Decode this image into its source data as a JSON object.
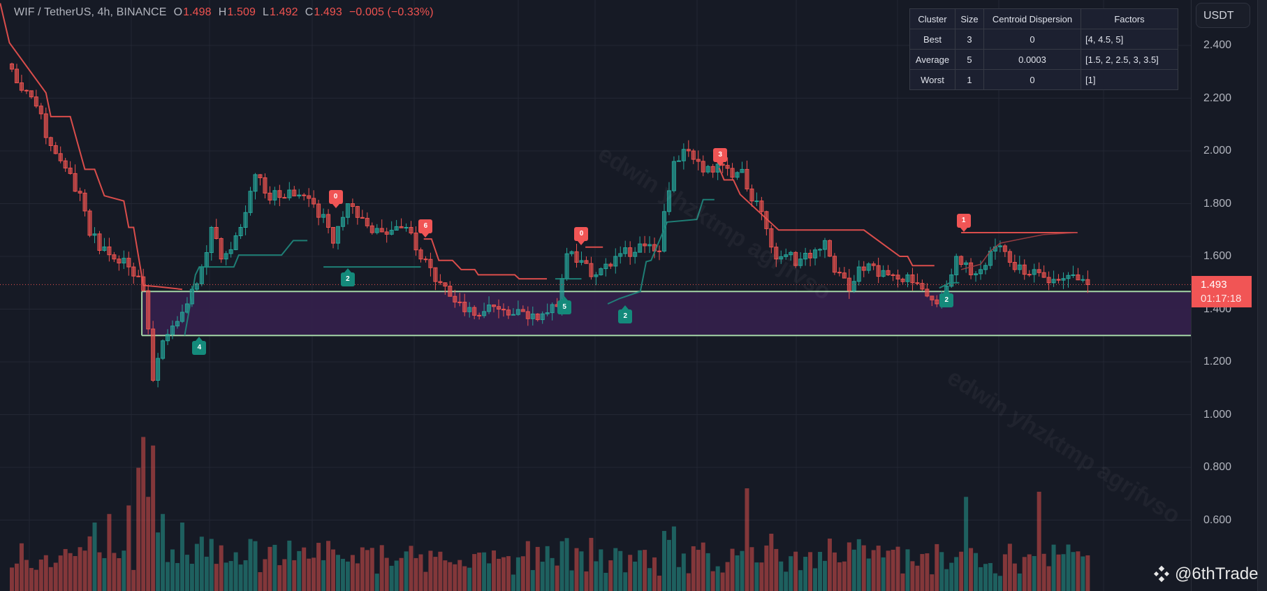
{
  "header": {
    "symbol": "WIF / TetherUS, 4h, BINANCE",
    "o_label": "O",
    "o": "1.498",
    "h_label": "H",
    "h": "1.509",
    "l_label": "L",
    "l": "1.492",
    "c_label": "C",
    "c": "1.493",
    "change": "−0.005 (−0.33%)"
  },
  "axis": {
    "currency": "USDT",
    "current_price": "1.493",
    "countdown": "01:17:18"
  },
  "cluster_table": {
    "headers": [
      "Cluster",
      "Size",
      "Centroid Dispersion",
      "Factors"
    ],
    "rows": [
      [
        "Best",
        "3",
        "0",
        "[4, 4.5, 5]"
      ],
      [
        "Average",
        "5",
        "0.0003",
        "[1.5, 2, 2.5, 3, 3.5]"
      ],
      [
        "Worst",
        "1",
        "0",
        "[1]"
      ]
    ]
  },
  "watermark": "edwin yhzktmp agrjfvso",
  "brand": "@6thTrade",
  "colors": {
    "up": "#26a69a",
    "down": "#ef5350",
    "zone_fill": "#33204a",
    "zone_line": "#a5d6a7",
    "bg": "#161a25"
  },
  "chart_data": {
    "type": "candlestick",
    "title": "WIF / TetherUS, 4h, BINANCE",
    "ylabel": "USDT",
    "ylim": [
      0.45,
      2.57
    ],
    "y_ticks": [
      "2.400",
      "2.200",
      "2.000",
      "1.800",
      "1.600",
      "1.400",
      "1.200",
      "1.000",
      "0.800",
      "0.600"
    ],
    "y_tick_values": [
      2.4,
      2.2,
      2.0,
      1.8,
      1.6,
      1.4,
      1.2,
      1.0,
      0.8,
      0.6
    ],
    "candle_count": 222,
    "close_anchors": [
      [
        0,
        2.31
      ],
      [
        5,
        2.17
      ],
      [
        8,
        2.02
      ],
      [
        14,
        1.84
      ],
      [
        16,
        1.68
      ],
      [
        21,
        1.59
      ],
      [
        24,
        1.56
      ],
      [
        27,
        1.47
      ],
      [
        29,
        1.13
      ],
      [
        31,
        1.28
      ],
      [
        36,
        1.42
      ],
      [
        39,
        1.56
      ],
      [
        41,
        1.71
      ],
      [
        43,
        1.59
      ],
      [
        47,
        1.71
      ],
      [
        50,
        1.91
      ],
      [
        52,
        1.84
      ],
      [
        61,
        1.82
      ],
      [
        65,
        1.71
      ],
      [
        66,
        1.65
      ],
      [
        69,
        1.8
      ],
      [
        74,
        1.69
      ],
      [
        81,
        1.71
      ],
      [
        84,
        1.59
      ],
      [
        88,
        1.5
      ],
      [
        93,
        1.39
      ],
      [
        100,
        1.4
      ],
      [
        108,
        1.36
      ],
      [
        112,
        1.41
      ],
      [
        114,
        1.61
      ],
      [
        120,
        1.53
      ],
      [
        124,
        1.6
      ],
      [
        130,
        1.64
      ],
      [
        133,
        1.62
      ],
      [
        134,
        1.77
      ],
      [
        136,
        1.96
      ],
      [
        139,
        2.0
      ],
      [
        142,
        1.92
      ],
      [
        145,
        1.95
      ],
      [
        148,
        1.9
      ],
      [
        150,
        1.93
      ],
      [
        152,
        1.81
      ],
      [
        154,
        1.77
      ],
      [
        157,
        1.59
      ],
      [
        162,
        1.59
      ],
      [
        167,
        1.66
      ],
      [
        169,
        1.54
      ],
      [
        172,
        1.47
      ],
      [
        174,
        1.56
      ],
      [
        180,
        1.53
      ],
      [
        185,
        1.5
      ],
      [
        190,
        1.42
      ],
      [
        193,
        1.53
      ],
      [
        194,
        1.6
      ],
      [
        197,
        1.53
      ],
      [
        199,
        1.55
      ],
      [
        201,
        1.62
      ],
      [
        203,
        1.64
      ],
      [
        206,
        1.55
      ],
      [
        210,
        1.55
      ],
      [
        213,
        1.5
      ],
      [
        218,
        1.53
      ],
      [
        221,
        1.493
      ]
    ],
    "volume_spikes": [
      [
        17,
        0.4
      ],
      [
        20,
        0.45
      ],
      [
        24,
        0.5
      ],
      [
        26,
        0.72
      ],
      [
        27,
        0.9
      ],
      [
        28,
        0.55
      ],
      [
        29,
        0.85
      ],
      [
        31,
        0.45
      ],
      [
        35,
        0.4
      ],
      [
        151,
        0.6
      ],
      [
        196,
        0.55
      ],
      [
        211,
        0.58
      ]
    ],
    "zone": {
      "top": 1.467,
      "bottom": 1.3,
      "start_index": 26.7
    },
    "last_price": 1.493,
    "trail_lines": [
      {
        "name": "bear-trail",
        "color": "#ef5350",
        "points": [
          [
            -2.4,
            2.56
          ],
          [
            -0.5,
            2.41
          ],
          [
            7,
            2.22
          ],
          [
            8,
            2.13
          ],
          [
            12,
            2.13
          ],
          [
            15,
            1.93
          ],
          [
            17,
            1.93
          ],
          [
            19,
            1.83
          ],
          [
            23,
            1.81
          ],
          [
            24,
            1.71
          ],
          [
            25,
            1.71
          ],
          [
            27,
            1.49
          ],
          [
            30,
            1.485
          ],
          [
            35,
            1.475
          ]
        ]
      },
      {
        "name": "bull-trail",
        "color": "#1f8a7e",
        "points": [
          [
            35.5,
            1.3
          ],
          [
            37.7,
            1.53
          ],
          [
            38.5,
            1.56
          ],
          [
            45.6,
            1.56
          ],
          [
            46.6,
            1.605
          ],
          [
            55.4,
            1.605
          ],
          [
            57.8,
            1.66
          ],
          [
            60.7,
            1.66
          ]
        ]
      },
      {
        "name": "bull-trail",
        "color": "#1f8a7e",
        "points": [
          [
            64,
            1.56
          ],
          [
            84,
            1.56
          ]
        ]
      },
      {
        "name": "bear-trail",
        "color": "#ef5350",
        "points": [
          [
            84.6,
            1.666
          ],
          [
            86.2,
            1.666
          ],
          [
            87.7,
            1.585
          ],
          [
            90.5,
            1.585
          ],
          [
            92.3,
            1.55
          ],
          [
            95.1,
            1.55
          ],
          [
            95.8,
            1.53
          ],
          [
            103.3,
            1.53
          ],
          [
            104.2,
            1.515
          ],
          [
            109.9,
            1.515
          ]
        ]
      },
      {
        "name": "bull-trail",
        "color": "#1f8a7e",
        "points": [
          [
            111.6,
            1.515
          ],
          [
            117,
            1.515
          ]
        ]
      },
      {
        "name": "bear-trail",
        "color": "#ef5350",
        "points": [
          [
            117.8,
            1.635
          ],
          [
            121.4,
            1.635
          ]
        ]
      },
      {
        "name": "bull-trail",
        "color": "#1f8a7e",
        "points": [
          [
            122.4,
            1.42
          ],
          [
            124.8,
            1.44
          ],
          [
            129.1,
            1.467
          ],
          [
            130.3,
            1.58
          ],
          [
            131.3,
            1.585
          ],
          [
            134.6,
            1.73
          ],
          [
            140.7,
            1.74
          ],
          [
            142,
            1.815
          ],
          [
            144.3,
            1.815
          ]
        ]
      },
      {
        "name": "bear-trail",
        "color": "#ef5350",
        "points": [
          [
            145.3,
            1.935
          ],
          [
            146.3,
            1.89
          ],
          [
            148.2,
            1.89
          ],
          [
            149.6,
            1.835
          ],
          [
            157.5,
            1.7
          ],
          [
            175,
            1.7
          ],
          [
            182.4,
            1.6
          ],
          [
            184,
            1.6
          ],
          [
            185,
            1.565
          ],
          [
            189.5,
            1.565
          ]
        ]
      },
      {
        "name": "bull-trail",
        "color": "#1f8a7e",
        "points": [
          [
            190.5,
            1.48
          ],
          [
            192.7,
            1.5
          ],
          [
            194.6,
            1.5
          ]
        ]
      },
      {
        "name": "bear-trail",
        "color": "#ef5350",
        "points": [
          [
            195,
            1.69
          ],
          [
            218.9,
            1.69
          ]
        ]
      },
      {
        "name": "bear-adaptive",
        "color": "#a33f44",
        "points": [
          [
            195,
            1.55
          ],
          [
            199,
            1.57
          ],
          [
            201,
            1.62
          ],
          [
            203,
            1.65
          ],
          [
            207,
            1.665
          ],
          [
            212,
            1.683
          ],
          [
            218.9,
            1.69
          ]
        ]
      }
    ],
    "signals": [
      {
        "label": "0",
        "dir": "down",
        "index": 66.5,
        "price": 1.78
      },
      {
        "label": "6",
        "dir": "down",
        "index": 85,
        "price": 1.67
      },
      {
        "label": "0",
        "dir": "down",
        "index": 117,
        "price": 1.64
      },
      {
        "label": "3",
        "dir": "down",
        "index": 145.5,
        "price": 1.94
      },
      {
        "label": "1",
        "dir": "down",
        "index": 195.5,
        "price": 1.69
      },
      {
        "label": "4",
        "dir": "up",
        "index": 38.5,
        "price": 1.3
      },
      {
        "label": "2",
        "dir": "up",
        "index": 69,
        "price": 1.56
      },
      {
        "label": "5",
        "dir": "up",
        "index": 113.5,
        "price": 1.455
      },
      {
        "label": "2",
        "dir": "up",
        "index": 126,
        "price": 1.42
      },
      {
        "label": "2",
        "dir": "up",
        "index": 192,
        "price": 1.48
      }
    ]
  }
}
